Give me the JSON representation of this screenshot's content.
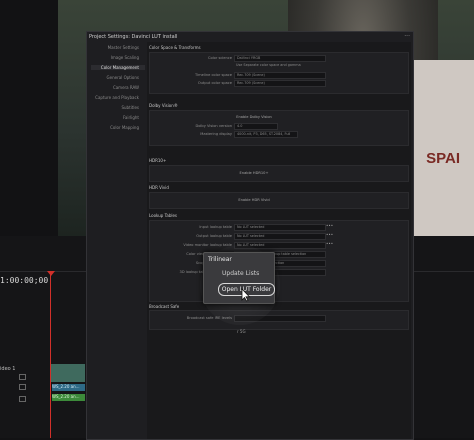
{
  "video": {
    "sign_text": "SPAI"
  },
  "timeline": {
    "timecode": "1:00:00;00",
    "track_label": "ideo 1",
    "clip1_label": "WS_2.20 an...",
    "clip2_label": "WS_2.20 an..."
  },
  "dialog": {
    "title": "Project Settings: Davinci LUT install",
    "close": "···"
  },
  "sidebar": {
    "items": [
      {
        "label": "Master Settings"
      },
      {
        "label": "Image Scaling"
      },
      {
        "label": "Color Management"
      },
      {
        "label": "General Options"
      },
      {
        "label": "Camera RAW"
      },
      {
        "label": "Capture and Playback"
      },
      {
        "label": "Subtitles"
      },
      {
        "label": "Fairlight"
      },
      {
        "label": "Color Mapping"
      }
    ],
    "active_index": 2
  },
  "sections": {
    "color_space": {
      "title": "Color Space & Transforms",
      "rows": [
        {
          "label": "Color science",
          "value": "DaVinci YRGB"
        },
        {
          "label": "",
          "value": "Use Separate color space and gamma"
        },
        {
          "label": "Timeline color space",
          "value": "Rec.709 (Scene)"
        },
        {
          "label": "Output color space",
          "value": "Rec.709 (Scene)"
        }
      ]
    },
    "dolby": {
      "title": "Dolby Vision®",
      "enable": "Enable Dolby Vision",
      "rows": [
        {
          "label": "Dolby Vision version",
          "value": "4.0"
        },
        {
          "label": "Mastering display",
          "value": "4000-nit, P3, D65, ST.2084, Full"
        }
      ]
    },
    "hdr10": {
      "title": "HDR10+",
      "enable": "Enable HDR10+"
    },
    "hdr_vivid": {
      "title": "HDR Vivid",
      "enable": "Enable HDR Vivid"
    },
    "lookup": {
      "title": "Lookup Tables",
      "rows": [
        {
          "label": "Input lookup table",
          "value": "No LUT selected"
        },
        {
          "label": "Output lookup table",
          "value": "No LUT selected"
        },
        {
          "label": "Video monitor lookup table",
          "value": "No LUT selected"
        },
        {
          "label": "Color viewer lookup table",
          "value": "Use video monitor lookup table selection"
        },
        {
          "label": "Scopes lookup table",
          "value": "Use video monitor selection"
        },
        {
          "label": "3D lookup table interpolation",
          "value": "Trilinear"
        }
      ],
      "dots": "•••"
    },
    "broadcast": {
      "title": "Broadcast Safe",
      "rows": [
        {
          "label": "Broadcast safe IRE levels",
          "value": ""
        }
      ],
      "footer": "r 5G"
    }
  },
  "menu": {
    "items": [
      {
        "label": "Trilinear"
      },
      {
        "label": "Update Lists"
      },
      {
        "label": "Open LUT Folder"
      }
    ]
  }
}
